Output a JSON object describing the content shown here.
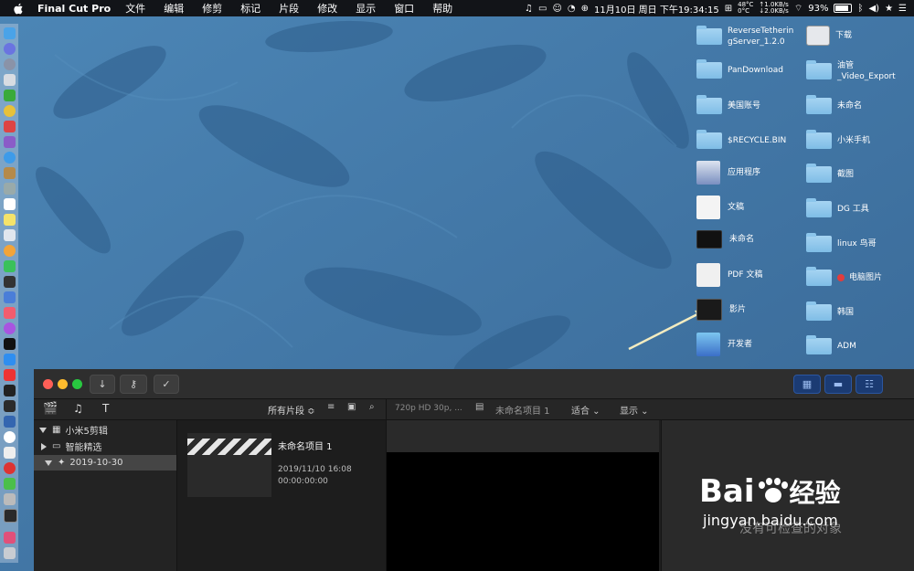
{
  "menubar": {
    "app": "Final Cut Pro",
    "items": [
      "文件",
      "编辑",
      "修剪",
      "标记",
      "片段",
      "修改",
      "显示",
      "窗口",
      "帮助"
    ],
    "datetime": "11月10日 周日 下午19:34:15",
    "temp": "48°C",
    "temp2": "0°C",
    "net_up": "↑1.0KB/s",
    "net_down": "↓2.0KB/s",
    "battery": "93%"
  },
  "desktop": {
    "items": [
      {
        "label": "ReverseTetherin gServer_1.2.0",
        "type": "folder"
      },
      {
        "label": "下载",
        "type": "drive"
      },
      {
        "label": "PanDownload",
        "type": "folder"
      },
      {
        "label": "油管 _Video_Export",
        "type": "folder"
      },
      {
        "label": "美国账号",
        "type": "folder"
      },
      {
        "label": "未命名",
        "type": "folder"
      },
      {
        "label": "$RECYCLE.BIN",
        "type": "folder"
      },
      {
        "label": "小米手机",
        "type": "folder"
      },
      {
        "label": "应用程序",
        "type": "app"
      },
      {
        "label": "截图",
        "type": "folder"
      },
      {
        "label": "文稿",
        "type": "doc"
      },
      {
        "label": "DG 工具",
        "type": "folder"
      },
      {
        "label": "未命名",
        "type": "image"
      },
      {
        "label": "linux 鸟哥",
        "type": "folder"
      },
      {
        "label": "PDF 文稿",
        "type": "doc"
      },
      {
        "label": "电脑图片",
        "type": "folder"
      },
      {
        "label": "影片",
        "type": "movie"
      },
      {
        "label": "韩国",
        "type": "folder"
      },
      {
        "label": "开发者",
        "type": "app"
      },
      {
        "label": "ADM",
        "type": "folder"
      }
    ]
  },
  "fcp": {
    "library_filter": "所有片段 ≎",
    "format": "720p HD 30p, ...",
    "project_name": "未命名项目 1",
    "fit_label": "适合",
    "display_label": "显示",
    "library": {
      "name": "小米5剪辑",
      "smart": "智能精选",
      "event": "2019-10-30"
    },
    "clip": {
      "title": "未命名项目 1",
      "date": "2019/11/10 16:08",
      "timecode": "00:00:00:00"
    },
    "inspector_empty": "没有可检查的对象"
  },
  "watermark": {
    "brand": "Bai",
    "brand2": "经验",
    "url": "jingyan.baidu.com"
  }
}
